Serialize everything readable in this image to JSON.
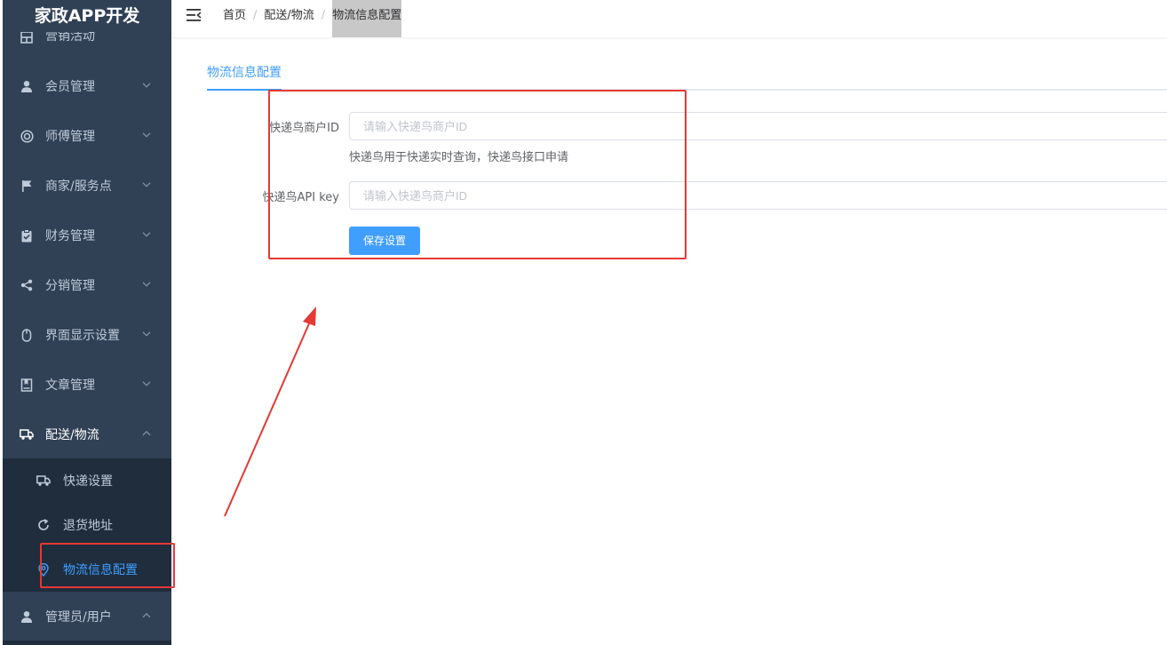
{
  "sidebar": {
    "logo": "家政APP开发",
    "items": [
      {
        "label": "营销活动",
        "icon": "grid-icon"
      },
      {
        "label": "会员管理",
        "icon": "user-icon"
      },
      {
        "label": "师傅管理",
        "icon": "lifebuoy-icon"
      },
      {
        "label": "商家/服务点",
        "icon": "flag-icon"
      },
      {
        "label": "财务管理",
        "icon": "clipboard-check-icon"
      },
      {
        "label": "分销管理",
        "icon": "share-icon"
      },
      {
        "label": "界面显示设置",
        "icon": "mouse-icon"
      },
      {
        "label": "文章管理",
        "icon": "book-icon"
      },
      {
        "label": "配送/物流",
        "icon": "truck-icon",
        "expanded": true
      },
      {
        "label": "管理员/用户",
        "icon": "user-icon",
        "expanded": true
      }
    ],
    "submenu": [
      {
        "label": "快递设置",
        "icon": "truck-icon"
      },
      {
        "label": "退货地址",
        "icon": "refresh-icon"
      },
      {
        "label": "物流信息配置",
        "icon": "location-icon",
        "active": true
      }
    ]
  },
  "navbar": {
    "breadcrumb": [
      "首页",
      "配送/物流",
      "物流信息配置"
    ],
    "separator": "/"
  },
  "main": {
    "tab": "物流信息配置",
    "form": {
      "merchant_id_label": "快递鸟商户ID",
      "merchant_id_placeholder": "请输入快递鸟商户ID",
      "merchant_id_value": "",
      "hint": "快递鸟用于快递实时查询，快递鸟接口申请",
      "api_key_label": "快递鸟API key",
      "api_key_placeholder": "请输入快递鸟商户ID",
      "api_key_value": "",
      "save_label": "保存设置"
    }
  },
  "colors": {
    "sidebar_bg": "#304156",
    "submenu_bg": "#1f2d3d",
    "menu_text": "#bfcbd9",
    "accent": "#409eff",
    "annotation": "#e53935"
  }
}
